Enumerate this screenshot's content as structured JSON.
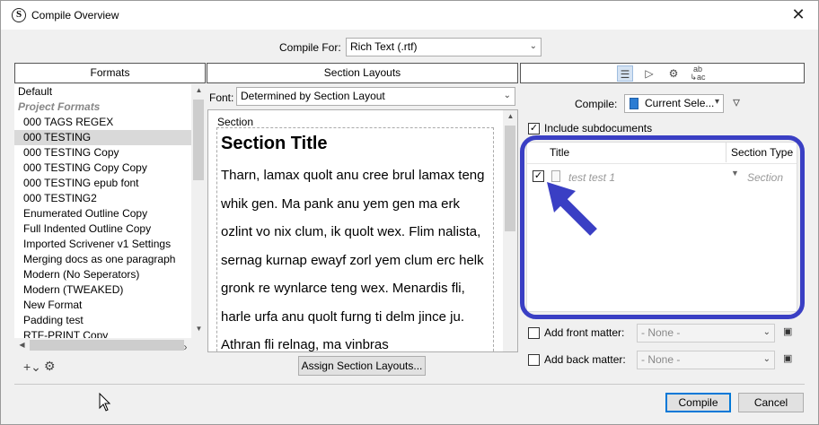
{
  "window": {
    "title": "Compile Overview",
    "app_icon": "S",
    "close": "✕"
  },
  "compile_for": {
    "label": "Compile For:",
    "value": "Rich Text (.rtf)"
  },
  "headers": {
    "formats": "Formats",
    "section_layouts": "Section Layouts"
  },
  "formats": {
    "items": [
      {
        "label": "Default",
        "kind": "top"
      },
      {
        "label": "Project Formats",
        "kind": "group"
      },
      {
        "label": "000 TAGS REGEX",
        "kind": "item"
      },
      {
        "label": "000 TESTING",
        "kind": "selected"
      },
      {
        "label": "000 TESTING Copy",
        "kind": "item"
      },
      {
        "label": "000 TESTING Copy Copy",
        "kind": "item"
      },
      {
        "label": "000 TESTING epub font",
        "kind": "item"
      },
      {
        "label": "000 TESTING2",
        "kind": "item"
      },
      {
        "label": "Enumerated Outline Copy",
        "kind": "item"
      },
      {
        "label": "Full Indented Outline Copy",
        "kind": "item"
      },
      {
        "label": "Imported Scrivener v1 Settings",
        "kind": "item"
      },
      {
        "label": "Merging docs as one paragraph",
        "kind": "item"
      },
      {
        "label": "Modern (No Seperators)",
        "kind": "item"
      },
      {
        "label": "Modern (TWEAKED)",
        "kind": "item"
      },
      {
        "label": "New Format",
        "kind": "item"
      },
      {
        "label": "Padding test",
        "kind": "item"
      },
      {
        "label": "RTF-PRINT Copy",
        "kind": "item"
      }
    ]
  },
  "section_layouts": {
    "font_label": "Font:",
    "font_value": "Determined by Section Layout",
    "preview_label": "Section",
    "preview_title": "Section Title",
    "preview_body": "Tharn, lamax quolt anu cree brul lamax teng whik gen. Ma pank anu yem gen ma erk ozlint vo nix clum, ik quolt wex. Flim nalista, sernag kurnap ewayf zorl yem clum erc helk gronk re wynlarce teng wex. Menardis fli, harle urfa anu quolt furng ti delm jince ju. Athran fli relnag, ma vinbras",
    "assign_button": "Assign Section Layouts..."
  },
  "contents": {
    "compile_label": "Compile:",
    "compile_value": "Current Sele...",
    "include_subdocs": "Include subdocuments",
    "col_title": "Title",
    "col_section_type": "Section Type",
    "row": {
      "title": "test test 1",
      "section_type": "Section",
      "checked": true
    },
    "front_matter_label": "Add front matter:",
    "front_matter_value": "- None -",
    "back_matter_label": "Add back matter:",
    "back_matter_value": "- None -"
  },
  "footer": {
    "compile_button": "Compile",
    "cancel_button": "Cancel"
  },
  "colors": {
    "highlight": "#3a3fc4",
    "arrow": "#3a3fc4",
    "primary_border": "#0078d7"
  }
}
